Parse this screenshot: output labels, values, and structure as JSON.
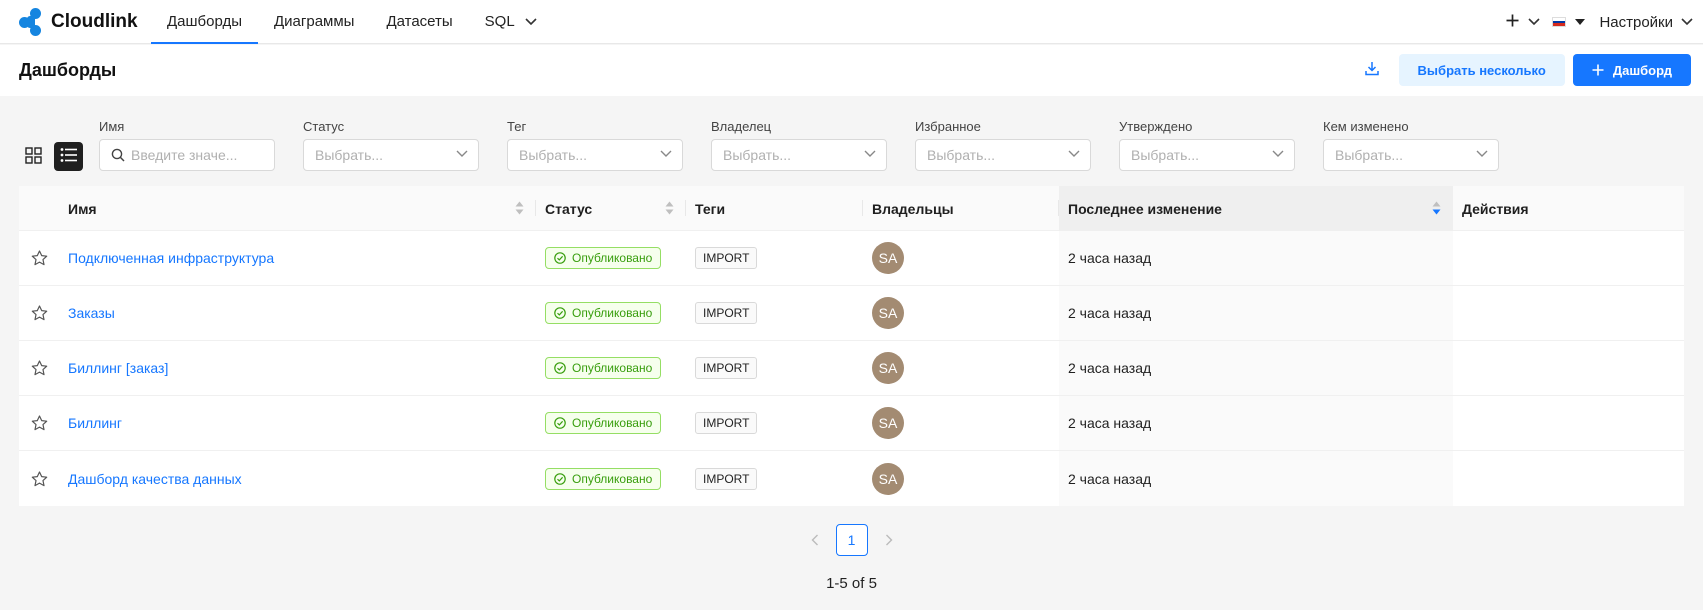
{
  "brand": {
    "name": "Cloudlink",
    "color": "#1585e0"
  },
  "nav": {
    "items": [
      {
        "label": "Дашборды",
        "active": true
      },
      {
        "label": "Диаграммы",
        "active": false
      },
      {
        "label": "Датасеты",
        "active": false
      },
      {
        "label": "SQL",
        "active": false
      }
    ],
    "settings_label": "Настройки"
  },
  "page": {
    "title": "Дашборды",
    "select_multiple_label": "Выбрать несколько",
    "new_dashboard_label": "Дашборд"
  },
  "filters": [
    {
      "label": "Имя",
      "placeholder": "Введите значе...",
      "type": "search"
    },
    {
      "label": "Статус",
      "placeholder": "Выбрать...",
      "type": "select"
    },
    {
      "label": "Тег",
      "placeholder": "Выбрать...",
      "type": "select"
    },
    {
      "label": "Владелец",
      "placeholder": "Выбрать...",
      "type": "select"
    },
    {
      "label": "Избранное",
      "placeholder": "Выбрать...",
      "type": "select"
    },
    {
      "label": "Утверждено",
      "placeholder": "Выбрать...",
      "type": "select"
    },
    {
      "label": "Кем изменено",
      "placeholder": "Выбрать...",
      "type": "select"
    }
  ],
  "table": {
    "columns": {
      "name": "Имя",
      "status": "Статус",
      "tags": "Теги",
      "owners": "Владельцы",
      "modified": "Последнее изменение",
      "actions": "Действия"
    },
    "rows": [
      {
        "name": "Подключенная инфраструктура",
        "status": "Опубликовано",
        "tag": "IMPORT",
        "owner": "SA",
        "modified": "2 часа назад"
      },
      {
        "name": "Заказы",
        "status": "Опубликовано",
        "tag": "IMPORT",
        "owner": "SA",
        "modified": "2 часа назад"
      },
      {
        "name": "Биллинг [заказ]",
        "status": "Опубликовано",
        "tag": "IMPORT",
        "owner": "SA",
        "modified": "2 часа назад"
      },
      {
        "name": "Биллинг",
        "status": "Опубликовано",
        "tag": "IMPORT",
        "owner": "SA",
        "modified": "2 часа назад"
      },
      {
        "name": "Дашборд качества данных",
        "status": "Опубликовано",
        "tag": "IMPORT",
        "owner": "SA",
        "modified": "2 часа назад"
      }
    ]
  },
  "pagination": {
    "current_page": "1",
    "range": "1-5 of 5"
  },
  "colors": {
    "accent": "#1677ff",
    "published_green": "#389e0d",
    "avatar": "#a38b72"
  }
}
